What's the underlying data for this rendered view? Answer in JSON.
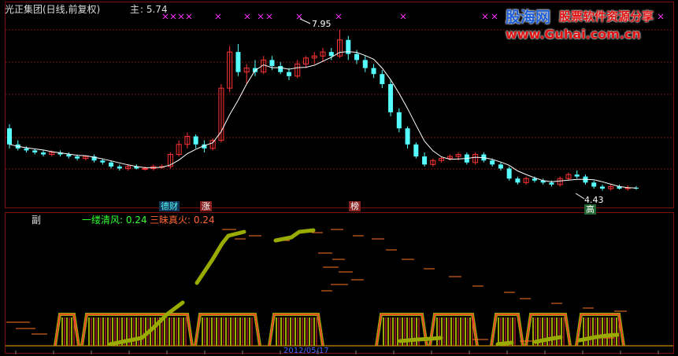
{
  "main_panel": {
    "title": "光正集团(日线,前复权)",
    "label": "主",
    "value_text": ": 5.74",
    "high_label": "7.95",
    "low_label": "4.43",
    "signal_labels": {
      "trade": "德财",
      "rise": "涨",
      "list": "榜",
      "high": "高"
    }
  },
  "sub_panel": {
    "label": "副",
    "series": [
      {
        "name": "一缕清风",
        "value_text": ": 0.24",
        "color": "#33ff33"
      },
      {
        "name": "三昧真火",
        "value_text": ": 0.24",
        "color": "#ff6633"
      }
    ],
    "date_text": "2012/05/17"
  },
  "watermark": {
    "brand": "股海网",
    "slogan": "股票软件资源分享",
    "url": "www.Guhai.com.cn"
  },
  "colors": {
    "bg": "#000000",
    "up": "#ff3333",
    "down": "#55ffff",
    "ma": "#ffffff",
    "grid": "#7a1010",
    "gold": "#ffaa00",
    "olive": "#99aa00",
    "marker": "#ff33ff"
  },
  "chart_data": {
    "type": "candlestick",
    "title": "光正集团(日线,前复权)",
    "ohlc": [
      [
        5.5,
        5.6,
        5.0,
        5.1
      ],
      [
        5.1,
        5.2,
        4.95,
        5.0
      ],
      [
        5.0,
        5.05,
        4.9,
        4.95
      ],
      [
        4.95,
        5.0,
        4.85,
        4.9
      ],
      [
        4.9,
        4.95,
        4.8,
        4.85
      ],
      [
        4.85,
        4.95,
        4.8,
        4.9
      ],
      [
        4.9,
        4.95,
        4.8,
        4.85
      ],
      [
        4.85,
        4.9,
        4.75,
        4.8
      ],
      [
        4.8,
        4.85,
        4.7,
        4.75
      ],
      [
        4.75,
        4.8,
        4.7,
        4.8
      ],
      [
        4.8,
        4.85,
        4.65,
        4.7
      ],
      [
        4.7,
        4.75,
        4.6,
        4.65
      ],
      [
        4.65,
        4.7,
        4.5,
        4.55
      ],
      [
        4.55,
        4.6,
        4.45,
        4.5
      ],
      [
        4.5,
        4.6,
        4.45,
        4.55
      ],
      [
        4.55,
        4.6,
        4.48,
        4.5
      ],
      [
        4.5,
        4.55,
        4.45,
        4.5
      ],
      [
        4.5,
        4.6,
        4.45,
        4.55
      ],
      [
        4.55,
        4.6,
        4.5,
        4.55
      ],
      [
        4.55,
        4.9,
        4.5,
        4.85
      ],
      [
        4.85,
        5.2,
        4.8,
        5.1
      ],
      [
        5.1,
        5.4,
        5.0,
        5.3
      ],
      [
        5.3,
        5.35,
        5.0,
        5.1
      ],
      [
        5.1,
        5.2,
        4.9,
        5.0
      ],
      [
        5.0,
        5.25,
        4.95,
        5.2
      ],
      [
        5.2,
        6.6,
        5.15,
        6.5
      ],
      [
        6.5,
        7.55,
        6.4,
        7.4
      ],
      [
        7.4,
        7.6,
        6.8,
        6.9
      ],
      [
        6.9,
        7.1,
        6.6,
        7.0
      ],
      [
        7.0,
        7.2,
        6.8,
        6.9
      ],
      [
        6.9,
        7.3,
        6.85,
        7.2
      ],
      [
        7.2,
        7.3,
        6.95,
        7.05
      ],
      [
        7.05,
        7.15,
        6.85,
        6.9
      ],
      [
        6.9,
        7.0,
        6.7,
        6.8
      ],
      [
        6.8,
        7.2,
        6.75,
        7.1
      ],
      [
        7.1,
        7.3,
        7.0,
        7.25
      ],
      [
        7.25,
        7.4,
        7.1,
        7.3
      ],
      [
        7.3,
        7.5,
        7.15,
        7.4
      ],
      [
        7.4,
        7.5,
        7.2,
        7.3
      ],
      [
        7.3,
        7.95,
        7.25,
        7.7
      ],
      [
        7.7,
        7.8,
        7.2,
        7.35
      ],
      [
        7.35,
        7.45,
        7.1,
        7.2
      ],
      [
        7.2,
        7.3,
        6.9,
        7.0
      ],
      [
        7.0,
        7.1,
        6.75,
        6.85
      ],
      [
        6.85,
        6.95,
        6.5,
        6.6
      ],
      [
        6.6,
        6.7,
        5.8,
        5.9
      ],
      [
        5.9,
        6.0,
        5.4,
        5.5
      ],
      [
        5.5,
        5.55,
        5.0,
        5.1
      ],
      [
        5.1,
        5.15,
        4.75,
        4.8
      ],
      [
        4.8,
        4.9,
        4.55,
        4.6
      ],
      [
        4.6,
        4.75,
        4.55,
        4.7
      ],
      [
        4.7,
        4.8,
        4.65,
        4.75
      ],
      [
        4.75,
        4.85,
        4.7,
        4.8
      ],
      [
        4.8,
        4.9,
        4.7,
        4.85
      ],
      [
        4.85,
        4.9,
        4.6,
        4.65
      ],
      [
        4.65,
        4.9,
        4.6,
        4.85
      ],
      [
        4.85,
        4.9,
        4.65,
        4.7
      ],
      [
        4.7,
        4.75,
        4.55,
        4.6
      ],
      [
        4.6,
        4.65,
        4.45,
        4.5
      ],
      [
        4.5,
        4.55,
        4.2,
        4.25
      ],
      [
        4.25,
        4.3,
        4.1,
        4.15
      ],
      [
        4.15,
        4.3,
        4.1,
        4.25
      ],
      [
        4.25,
        4.3,
        4.15,
        4.2
      ],
      [
        4.2,
        4.25,
        4.1,
        4.15
      ],
      [
        4.15,
        4.2,
        4.05,
        4.1
      ],
      [
        4.1,
        4.3,
        4.05,
        4.25
      ],
      [
        4.25,
        4.4,
        4.2,
        4.35
      ],
      [
        4.35,
        4.45,
        4.25,
        4.3
      ],
      [
        4.3,
        4.35,
        4.1,
        4.15
      ],
      [
        4.15,
        4.2,
        4.0,
        4.05
      ],
      [
        4.05,
        4.1,
        3.95,
        4.0
      ],
      [
        4.0,
        4.1,
        3.95,
        4.05
      ],
      [
        4.05,
        4.1,
        3.98,
        4.0
      ],
      [
        4.0,
        4.08,
        3.95,
        4.02
      ],
      [
        4.02,
        4.06,
        3.97,
        4.0
      ]
    ],
    "y_high": 7.95,
    "y_low": 4.43
  }
}
